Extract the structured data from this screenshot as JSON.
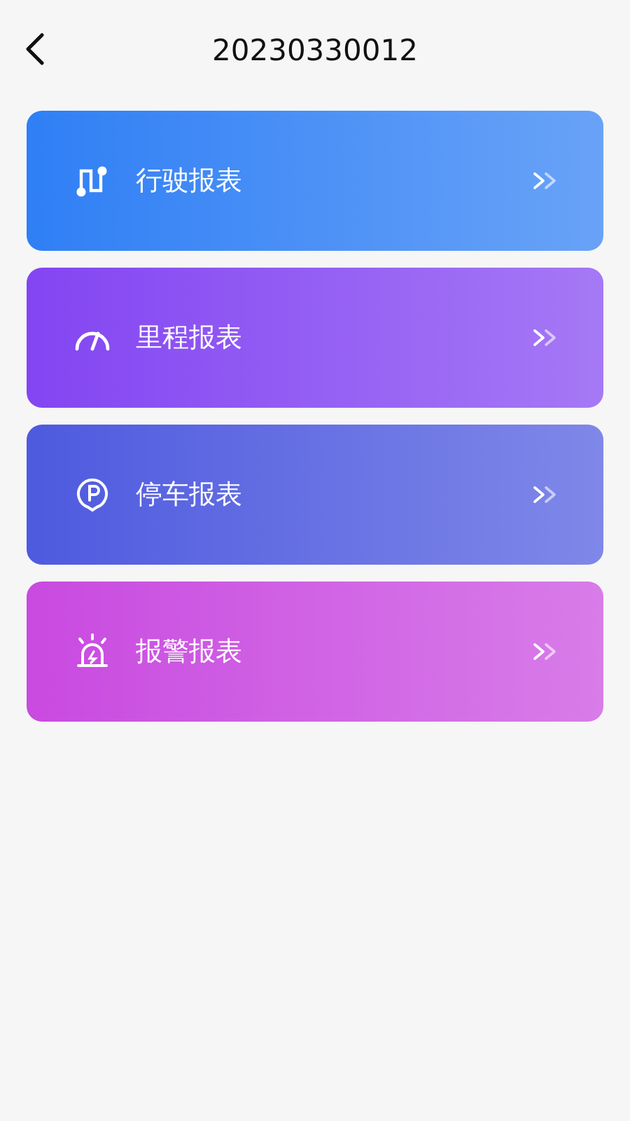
{
  "header": {
    "title": "20230330012"
  },
  "reports": [
    {
      "label": "行驶报表",
      "kind": "route",
      "color": "#2f7ff5"
    },
    {
      "label": "里程报表",
      "kind": "gauge",
      "color": "#8345f2"
    },
    {
      "label": "停车报表",
      "kind": "parking",
      "color": "#4e5adf"
    },
    {
      "label": "报警报表",
      "kind": "alarm",
      "color": "#c94ae0"
    }
  ]
}
